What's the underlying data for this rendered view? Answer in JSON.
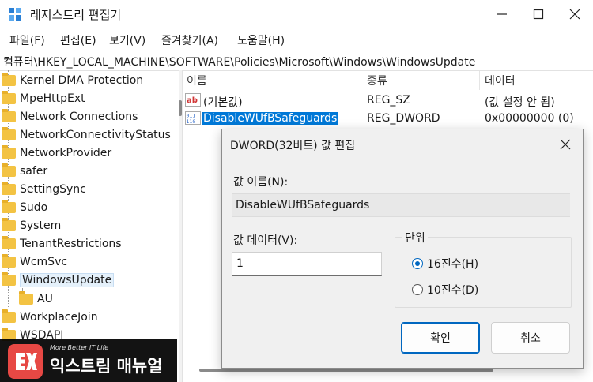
{
  "window": {
    "title": "레지스트리 편집기",
    "minimize_icon": "minimize-icon",
    "maximize_icon": "maximize-icon",
    "close_icon": "close-icon"
  },
  "menu": {
    "file": "파일(F)",
    "edit": "편집(E)",
    "view": "보기(V)",
    "favorites": "즐겨찾기(A)",
    "help": "도움말(H)"
  },
  "address": "컴퓨터\\HKEY_LOCAL_MACHINE\\SOFTWARE\\Policies\\Microsoft\\Windows\\WindowsUpdate",
  "tree": {
    "items": [
      "Kernel DMA Protection",
      "MpeHttpExt",
      "Network Connections",
      "NetworkConnectivityStatus",
      "NetworkProvider",
      "safer",
      "SettingSync",
      "Sudo",
      "System",
      "TenantRestrictions",
      "WcmSvc",
      "WindowsUpdate",
      "AU",
      "WorkplaceJoin",
      "WSDAPI"
    ],
    "selected": "WindowsUpdate"
  },
  "list": {
    "columns": [
      "이름",
      "종류",
      "데이터"
    ],
    "rows": [
      {
        "icon": "string-value-icon",
        "name": "(기본값)",
        "type": "REG_SZ",
        "data": "(값 설정 안 됨)"
      },
      {
        "icon": "binary-value-icon",
        "name": "DisableWUfBSafeguards",
        "type": "REG_DWORD",
        "data": "0x00000000 (0)"
      }
    ]
  },
  "dialog": {
    "title": "DWORD(32비트) 값 편집",
    "value_name_label": "값 이름(N):",
    "value_name": "DisableWUfBSafeguards",
    "value_data_label": "값 데이터(V):",
    "value_data": "1",
    "base_label": "단위",
    "hex_label": "16진수(H)",
    "dec_label": "10진수(D)",
    "selected_base": "hex",
    "ok_label": "확인",
    "cancel_label": "취소"
  },
  "watermark": {
    "tagline": "More Better IT Life",
    "name": "익스트림 매뉴얼",
    "badge_icon": "ex-logo-icon"
  },
  "colors": {
    "selection": "#0078d7",
    "accent": "#0067c0",
    "folder": "#f3c343",
    "badge": "#e53935"
  }
}
